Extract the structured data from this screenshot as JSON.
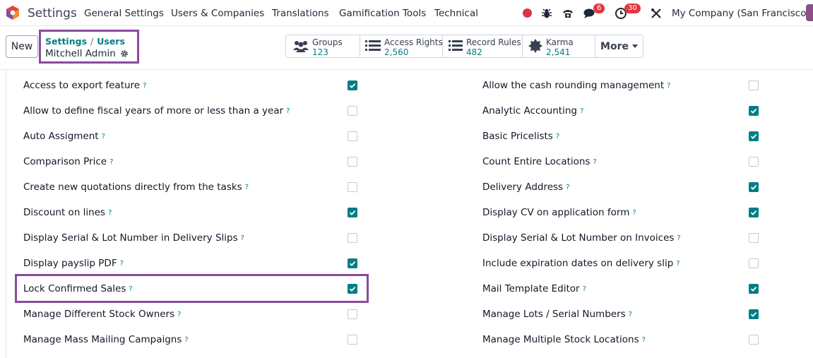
{
  "navbar": {
    "app_name": "Settings",
    "menu": [
      "General Settings",
      "Users & Companies",
      "Translations",
      "Gamification Tools",
      "Technical"
    ],
    "messages_count": "6",
    "activities_count": "30",
    "company": "My Company (San Francisco)"
  },
  "control_panel": {
    "new_label": "New",
    "breadcrumb": {
      "parent": "Settings",
      "current": "Users",
      "record": "Mitchell Admin"
    },
    "stats": [
      {
        "label": "Groups",
        "value": "123",
        "icon": "users-icon"
      },
      {
        "label": "Access Rights",
        "value": "2,560",
        "icon": "list-icon"
      },
      {
        "label": "Record Rules",
        "value": "482",
        "icon": "list-icon"
      },
      {
        "label": "Karma",
        "value": "2,541",
        "icon": "badge-icon"
      }
    ],
    "more_label": "More"
  },
  "settings": {
    "left": [
      {
        "label": "Access to export feature",
        "checked": true
      },
      {
        "label": "Allow to define fiscal years of more or less than a year",
        "checked": false
      },
      {
        "label": "Auto Assigment",
        "checked": false
      },
      {
        "label": "Comparison Price",
        "checked": false
      },
      {
        "label": "Create new quotations directly from the tasks",
        "checked": false
      },
      {
        "label": "Discount on lines",
        "checked": true
      },
      {
        "label": "Display Serial & Lot Number in Delivery Slips",
        "checked": false
      },
      {
        "label": "Display payslip PDF",
        "checked": true
      },
      {
        "label": "Lock Confirmed Sales",
        "checked": true
      },
      {
        "label": "Manage Different Stock Owners",
        "checked": false
      },
      {
        "label": "Manage Mass Mailing Campaigns",
        "checked": false
      }
    ],
    "right": [
      {
        "label": "Allow the cash rounding management",
        "checked": false
      },
      {
        "label": "Analytic Accounting",
        "checked": true
      },
      {
        "label": "Basic Pricelists",
        "checked": true
      },
      {
        "label": "Count Entire Locations",
        "checked": false
      },
      {
        "label": "Delivery Address",
        "checked": true
      },
      {
        "label": "Display CV on application form",
        "checked": true
      },
      {
        "label": "Display Serial & Lot Number on Invoices",
        "checked": false
      },
      {
        "label": "Include expiration dates on delivery slip",
        "checked": false
      },
      {
        "label": "Mail Template Editor",
        "checked": true
      },
      {
        "label": "Manage Lots / Serial Numbers",
        "checked": true
      },
      {
        "label": "Manage Multiple Stock Locations",
        "checked": false
      }
    ],
    "help_glyph": "?"
  }
}
